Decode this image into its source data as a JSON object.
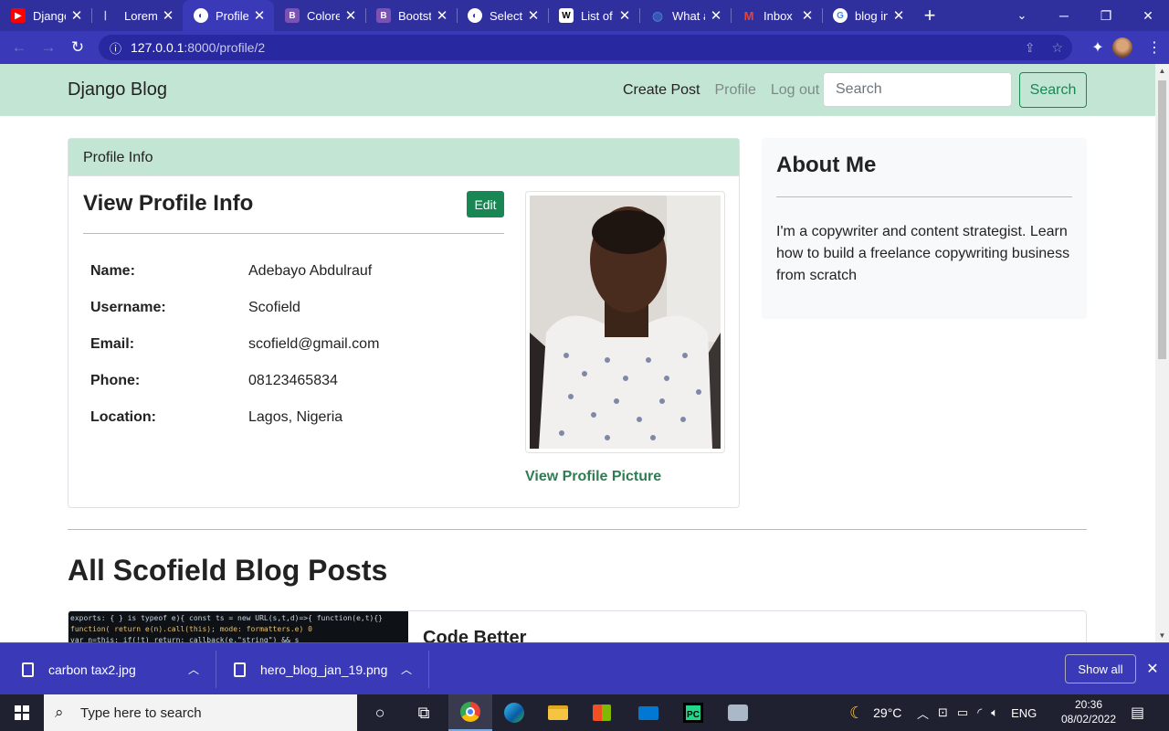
{
  "browser": {
    "tabs": [
      {
        "title": "Django",
        "icon": "youtube-icon",
        "color": "#ff0000"
      },
      {
        "title": "Lorem",
        "icon": "page-icon",
        "color": "#555555"
      },
      {
        "title": "Profile",
        "icon": "globe-icon",
        "color": "#ffffff"
      },
      {
        "title": "Colore",
        "icon": "bootstrap-icon",
        "color": "#7952b3"
      },
      {
        "title": "Bootst",
        "icon": "bootstrap-icon",
        "color": "#7952b3"
      },
      {
        "title": "Select",
        "icon": "globe-icon",
        "color": "#ffffff"
      },
      {
        "title": "List of",
        "icon": "wikipedia-icon",
        "color": "#ffffff"
      },
      {
        "title": "What a",
        "icon": "globe-icon",
        "color": "#4a8fd8"
      },
      {
        "title": "Inbox (",
        "icon": "gmail-icon",
        "color": "#ea4335"
      },
      {
        "title": "blog in",
        "icon": "google-icon",
        "color": "#4285f4"
      }
    ],
    "active_tab": 2,
    "url_host": "127.0.0.1",
    "url_path": ":8000/profile/2"
  },
  "site": {
    "brand": "Django Blog",
    "nav": {
      "create": "Create Post",
      "profile": "Profile",
      "logout": "Log out"
    },
    "search_placeholder": "Search",
    "search_button": "Search",
    "accent_color": "#198754",
    "navbar_color": "#c3e6d4"
  },
  "profile": {
    "card_header": "Profile Info",
    "card_title": "View Profile Info",
    "edit_label": "Edit",
    "fields": [
      {
        "label": "Name:",
        "value": "Adebayo Abdulrauf"
      },
      {
        "label": "Username:",
        "value": "Scofield"
      },
      {
        "label": "Email:",
        "value": "scofield@gmail.com"
      },
      {
        "label": "Phone:",
        "value": "08123465834"
      },
      {
        "label": "Location:",
        "value": "Lagos, Nigeria"
      }
    ],
    "view_picture": "View Profile Picture"
  },
  "about": {
    "title": "About Me",
    "text": "I'm a copywriter and content strategist. Learn how to build a freelance copywriting business from scratch"
  },
  "posts": {
    "heading": "All Scofield Blog Posts",
    "first_title": "Code Better"
  },
  "downloads": {
    "items": [
      "carbon tax2.jpg",
      "hero_blog_jan_19.png"
    ],
    "show_all": "Show all"
  },
  "taskbar": {
    "search_placeholder": "Type here to search",
    "temperature": "29°C",
    "language": "ENG",
    "time": "20:36",
    "date": "08/02/2022"
  }
}
